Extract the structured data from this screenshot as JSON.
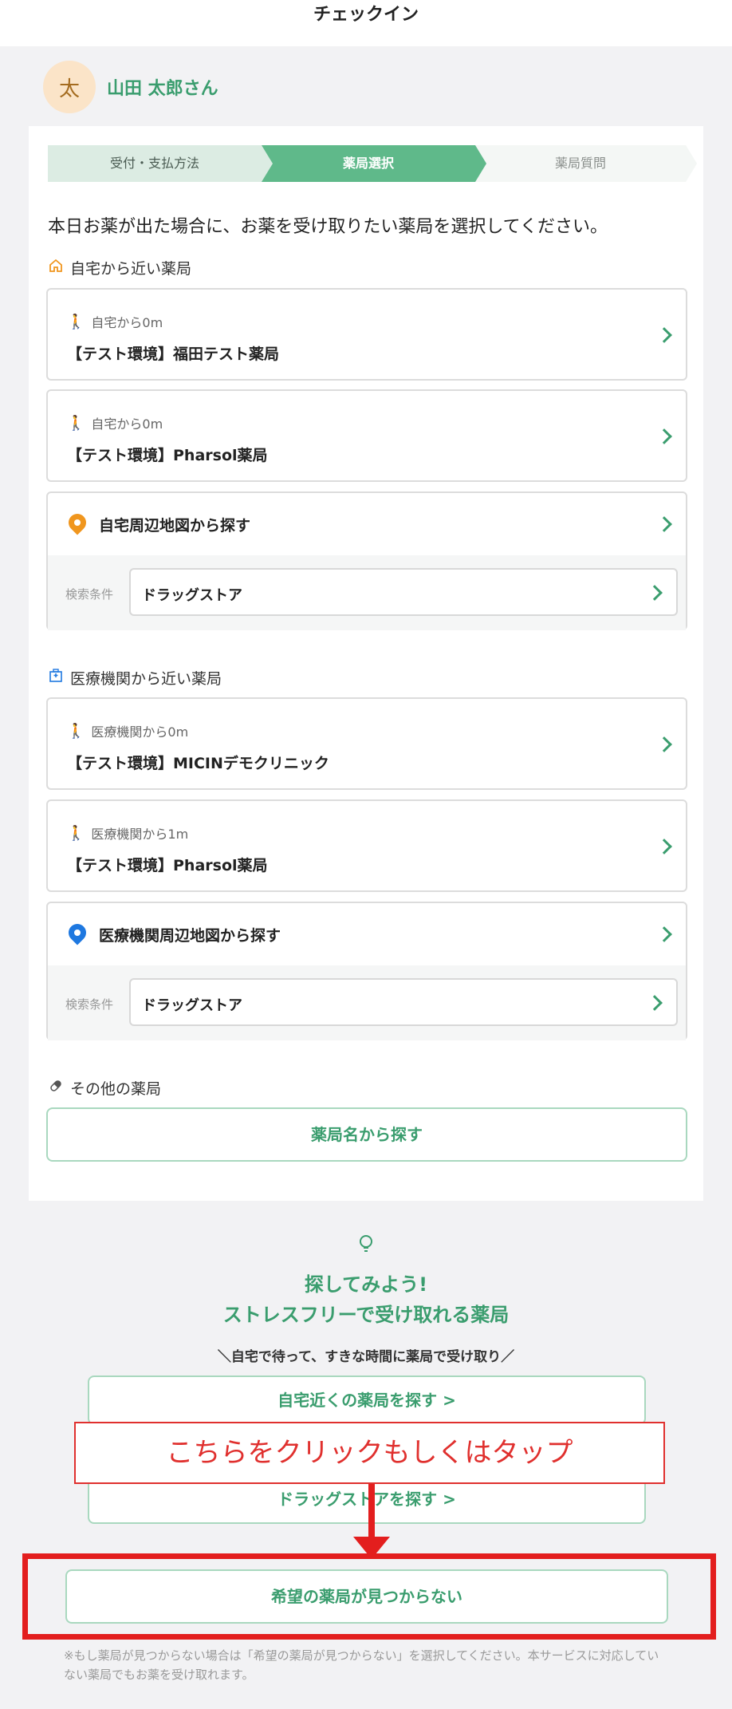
{
  "header": {
    "title": "チェックイン"
  },
  "user": {
    "avatar_initial": "太",
    "name": "山田 太郎さん"
  },
  "stepper": {
    "steps": [
      "受付・支払方法",
      "薬局選択",
      "薬局質問"
    ],
    "active_index": 1
  },
  "intro": "本日お薬が出た場合に、お薬を受け取りたい薬局を選択してください。",
  "home_section": {
    "title": "自宅から近い薬局",
    "items": [
      {
        "distance": "自宅から0m",
        "name": "【テスト環境】福田テスト薬局"
      },
      {
        "distance": "自宅から0m",
        "name": "【テスト環境】Pharsol薬局"
      }
    ],
    "map": {
      "label": "自宅周辺地図から探す",
      "condition_label": "検索条件",
      "condition_value": "ドラッグストア"
    }
  },
  "clinic_section": {
    "title": "医療機関から近い薬局",
    "items": [
      {
        "distance": "医療機関から0m",
        "name": "【テスト環境】MICINデモクリニック"
      },
      {
        "distance": "医療機関から1m",
        "name": "【テスト環境】Pharsol薬局"
      }
    ],
    "map": {
      "label": "医療機関周辺地図から探す",
      "condition_label": "検索条件",
      "condition_value": "ドラッグストア"
    }
  },
  "other_section": {
    "title": "その他の薬局",
    "button": "薬局名から探す"
  },
  "promo": {
    "title_line1": "探してみよう!",
    "title_line2": "ストレスフリーで受け取れる薬局",
    "subtitle": "＼自宅で待って、すきな時間に薬局で受け取り／",
    "button1": "自宅近くの薬局を探す  >",
    "button2": "ドラッグストアを探す  >"
  },
  "callout": "こちらをクリックもしくはタップ",
  "not_found_button": "希望の薬局が見つからない",
  "note": "※もし薬局が見つからない場合は「希望の薬局が見つからない」を選択してください。本サービスに対応していない薬局でもお薬を受け取れます。",
  "colors": {
    "accent": "#3a9d6e",
    "highlight_red": "#e31e1e",
    "home_pin": "#f0961e",
    "clinic_pin": "#1e78e0"
  }
}
